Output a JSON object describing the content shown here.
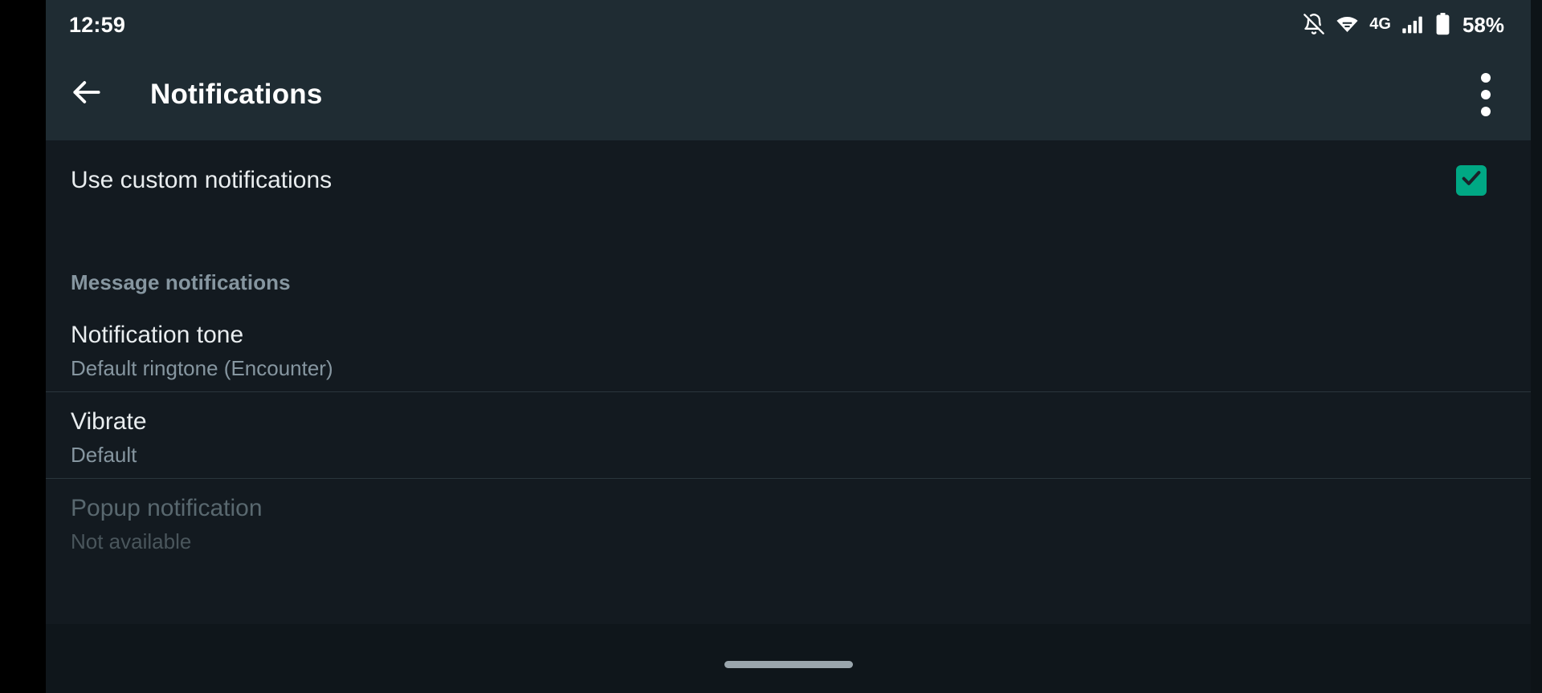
{
  "colors": {
    "status_bar_bg": "#1f2c33",
    "app_bar_bg": "#1f2c33",
    "content_bg": "#131a20",
    "accent_checkbox": "#00a884",
    "primary_text": "#e9edef",
    "secondary_text": "#8696a0",
    "disabled_text": "#59686f",
    "divider": "#2a353c",
    "bezel": "#000000"
  },
  "status_bar": {
    "clock": "12:59",
    "battery_percent": "58%",
    "network_label": "4G",
    "icons": [
      "notifications-off-icon",
      "wifi-icon",
      "mobile-network-label",
      "signal-bars-icon",
      "battery-icon"
    ]
  },
  "app_bar": {
    "title": "Notifications",
    "back_icon": "arrow-back-icon",
    "overflow_icon": "more-vertical-icon"
  },
  "content": {
    "custom_notifications": {
      "title": "Use custom notifications",
      "checked": true,
      "checkbox_icon": "checkmark-icon"
    },
    "section_message_notifications": {
      "title": "Message notifications"
    },
    "rows": [
      {
        "name": "notification-tone",
        "title": "Notification tone",
        "subtitle": "Default ringtone (Encounter)",
        "enabled": true
      },
      {
        "name": "vibrate",
        "title": "Vibrate",
        "subtitle": "Default",
        "enabled": true
      },
      {
        "name": "popup-notification",
        "title": "Popup notification",
        "subtitle": "Not available",
        "enabled": false
      }
    ]
  },
  "navigation": {
    "gesture_bar": "home-gesture-bar"
  }
}
